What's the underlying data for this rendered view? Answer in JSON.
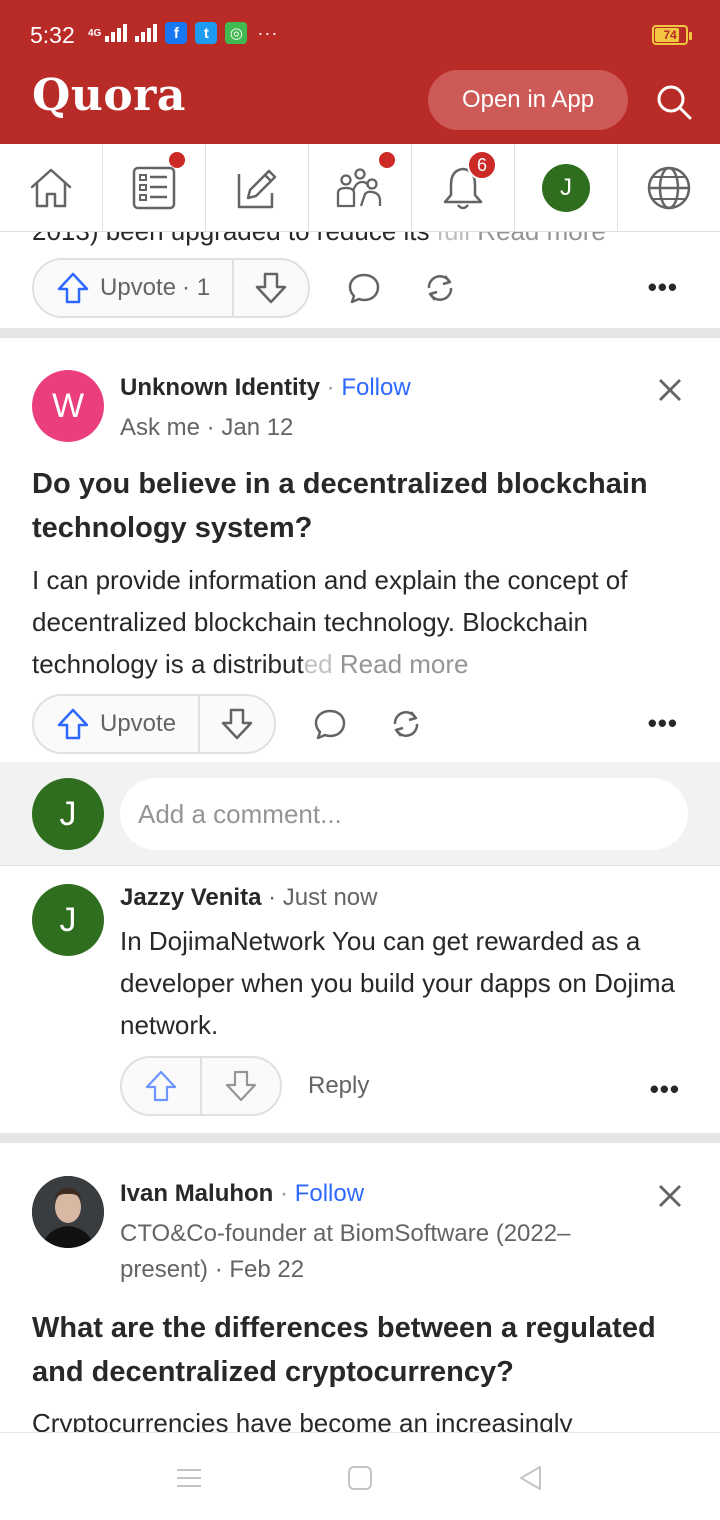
{
  "status_bar": {
    "time": "5:32",
    "network": "4G",
    "battery": "74",
    "battery_level": 0.74,
    "more": "···",
    "apps": [
      {
        "icon": "facebook-icon",
        "glyph": "f",
        "color": "#1877f2"
      },
      {
        "icon": "twitter-icon",
        "glyph": "t",
        "color": "#1d9bf0"
      },
      {
        "icon": "chat-app-icon",
        "glyph": "◎",
        "color": "#3fb950"
      }
    ]
  },
  "header": {
    "logo": "Quora",
    "open_app_label": "Open in App",
    "search_icon": "search-icon"
  },
  "nav": {
    "items": [
      {
        "name": "home",
        "icon": "home-icon",
        "dot": false
      },
      {
        "name": "following",
        "icon": "feed-list-icon",
        "dot": true
      },
      {
        "name": "answer",
        "icon": "edit-icon",
        "dot": false
      },
      {
        "name": "spaces",
        "icon": "people-icon",
        "dot": true
      },
      {
        "name": "notifications",
        "icon": "bell-icon",
        "badge": "6"
      },
      {
        "name": "profile",
        "icon": "avatar",
        "avatar_letter": "J"
      },
      {
        "name": "languages",
        "icon": "globe-icon"
      }
    ]
  },
  "feed": {
    "prev_post": {
      "cut_text": "2013) been upgraded to reduce its ",
      "cut_fade": "full",
      "read_more": "Read more",
      "upvote_label": "Upvote",
      "upvote_count": "· 1"
    },
    "post1": {
      "avatar_letter": "W",
      "avatar_color": "#ea3f7c",
      "author": "Unknown Identity",
      "dot": "·",
      "follow_label": "Follow",
      "credential": "Ask me · Jan 12",
      "question": "Do you believe in a decentralized blockchain technology system?",
      "answer_main": "I can provide information and explain the concept of decentralized blockchain technology. Blockchain technology is a distribut",
      "answer_fade": "ed",
      "read_more": "Read more",
      "upvote_label": "Upvote"
    },
    "comment_box": {
      "avatar_letter": "J",
      "placeholder": "Add a comment..."
    },
    "comment": {
      "avatar_letter": "J",
      "author": "Jazzy Venita",
      "time": "· Just now",
      "body": "In DojimaNetwork You can get rewarded as a developer when you build your dapps on Dojima network.",
      "reply_label": "Reply"
    },
    "post2": {
      "author": "Ivan Maluhon",
      "dot": "·",
      "follow_label": "Follow",
      "credential": "CTO&Co-founder at BiomSoftware (2022–present) · Feb 22",
      "question": "What are the differences between a regulated and decentralized cryptocurrency?",
      "answer_cut": "Cryptocurrencies have become an increasingly"
    }
  },
  "system_nav": {
    "items": [
      "menu-icon",
      "home-square-icon",
      "back-triangle-icon"
    ]
  },
  "colors": {
    "brand": "#b92b27",
    "link": "#2e69ff",
    "upvote_blue": "#2e69ff",
    "badge_red": "#cb2a27",
    "avatar_green": "#2f6e1f"
  }
}
